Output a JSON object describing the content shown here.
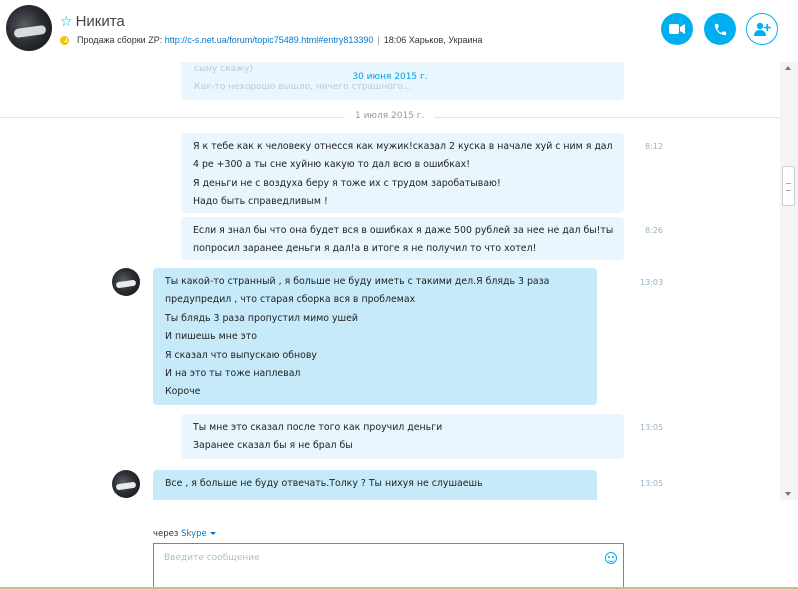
{
  "contact": {
    "name": "Никита",
    "mood_prefix": "Продажа сборки ZP:",
    "mood_link": "http://c-s.net.ua/forum/topic75489.html#entry813390",
    "separator": "|",
    "local_info": "18:06 Харьков, Украина"
  },
  "header_buttons": {
    "video_call": "video-camera-icon",
    "audio_call": "phone-icon",
    "add_people": "add-person-icon"
  },
  "chat": {
    "faded_lines": [
      "сыну скажу)",
      "Как-то нехорошо вышло, ничего страшного..."
    ],
    "sticky_date": "30 июня 2015 г.",
    "date_separator": "1 июля 2015 г.",
    "messages": [
      {
        "direction": "outgoing",
        "time": "8:12",
        "lines": [
          "Я к тебе как к человеку отнесся как мужик!сказал 2 куска в начале хуй с ним я дал 4 ре +300 а ты сне хуйню какую то дал всю в ошибках!",
          "Я деньги не с воздуха беру я тоже их с трудом заробатываю!",
          "Надо быть справедливым !"
        ]
      },
      {
        "direction": "outgoing",
        "time": "8:26",
        "lines": [
          "Если я знал бы что она будет вся в ошибках я даже 500 рублей за нее не дал бы!ты попросил заранее деньги я дал!а в итоге я не получил то что хотел!"
        ]
      },
      {
        "direction": "incoming",
        "time": "13:03",
        "lines": [
          "Ты какой-то странный , я больше не буду иметь с такими дел.Я блядь 3 раза предупредил , что старая сборка вся в проблемах",
          "Ты блядь 3 раза пропустил мимо ушей",
          "И пишешь мне это",
          "Я сказал что выпускаю обнову",
          "И на это ты тоже наплевал",
          "Короче"
        ]
      },
      {
        "direction": "outgoing",
        "time": "13:05",
        "lines": [
          "Ты мне это сказал после того как проучил деньги",
          "Заранее сказал бы я не брал бы"
        ]
      },
      {
        "direction": "incoming",
        "time": "13:05",
        "lines": [
          "Все , я больше не буду отвечать.Толку ? Ты нихуя не слушаешь"
        ]
      }
    ]
  },
  "compose": {
    "via_label": "через",
    "via_service": "Skype",
    "placeholder": "Введите сообщение"
  }
}
